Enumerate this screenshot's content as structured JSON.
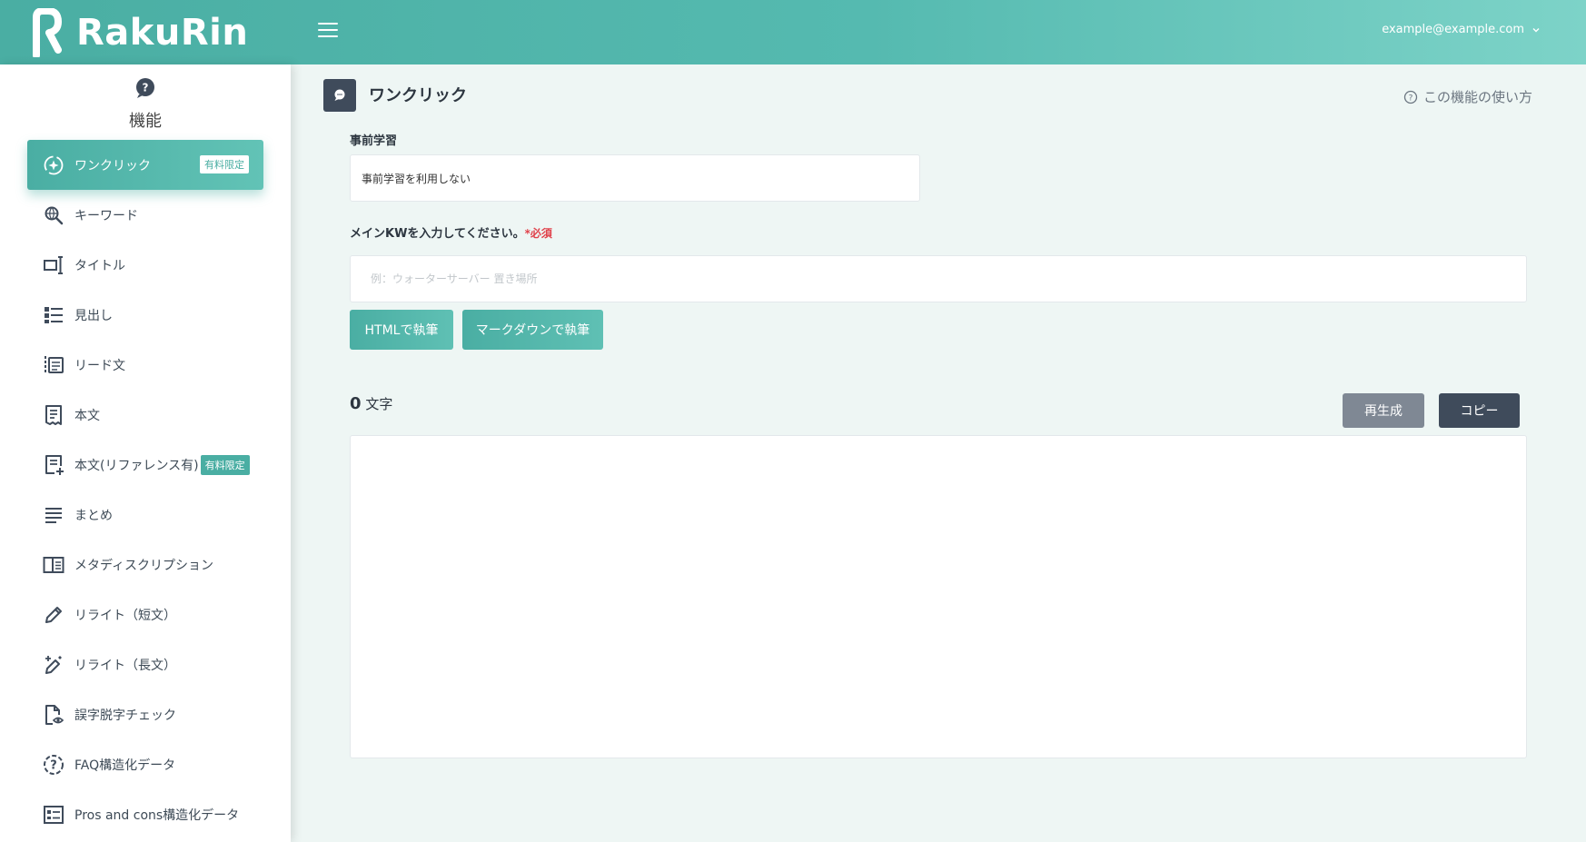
{
  "header": {
    "brand": "RakuRin",
    "account_email": "example@example.com"
  },
  "sidebar": {
    "title": "機能",
    "items": [
      {
        "label": "ワンクリック",
        "badge": "有料限定",
        "icon": "sparkle-circle-icon",
        "active": true
      },
      {
        "label": "キーワード",
        "icon": "search-globe-icon"
      },
      {
        "label": "タイトル",
        "icon": "text-cursor-icon"
      },
      {
        "label": "見出し",
        "icon": "list-heading-icon"
      },
      {
        "label": "リード文",
        "icon": "lead-text-icon"
      },
      {
        "label": "本文",
        "icon": "document-icon"
      },
      {
        "label": "本文(リファレンス有)",
        "badge": "有料限定",
        "icon": "document-add-icon"
      },
      {
        "label": "まとめ",
        "icon": "summary-lines-icon"
      },
      {
        "label": "メタディスクリプション",
        "icon": "meta-panel-icon"
      },
      {
        "label": "リライト（短文）",
        "icon": "pencil-icon"
      },
      {
        "label": "リライト（長文）",
        "icon": "magic-pencil-icon"
      },
      {
        "label": "誤字脱字チェック",
        "icon": "file-eye-icon"
      },
      {
        "label": "FAQ構造化データ",
        "icon": "faq-circle-icon"
      },
      {
        "label": "Pros and cons構造化データ",
        "icon": "pros-cons-icon"
      }
    ]
  },
  "main": {
    "title": "ワンクリック",
    "help_link": "この機能の使い方",
    "pretraining": {
      "label": "事前学習",
      "value": "事前学習を利用しない"
    },
    "keyword": {
      "label": "メインKWを入力してください。",
      "required": "*必須",
      "placeholder": "例：ウォーターサーバー 置き場所",
      "value": ""
    },
    "buttons": {
      "html": "HTMLで執筆",
      "markdown": "マークダウンで執筆",
      "regenerate": "再生成",
      "copy": "コピー"
    },
    "char_count": "0",
    "char_unit": "文字"
  },
  "colors": {
    "primary": "#4aaea3",
    "dark": "#3f4b5b",
    "required": "#e0424b"
  }
}
